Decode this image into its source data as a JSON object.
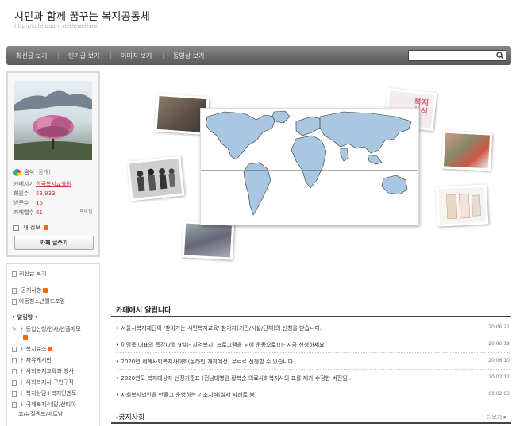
{
  "header": {
    "title": "시민과 함께 꿈꾸는 복지공동체",
    "url": "http://cafe.daum.net/ewelfare"
  },
  "topnav": {
    "items": [
      "최신글 보기",
      "인기글 보기",
      "이미지 보기",
      "동영상 보기"
    ],
    "search_placeholder": ""
  },
  "profile": {
    "owner_label": "음식",
    "owner_sub": "(공개)",
    "stats": [
      {
        "label": "카페지기",
        "value": "한국복지교육원"
      },
      {
        "label": "회원수",
        "value": "53,933"
      },
      {
        "label": "방문수",
        "value": "16"
      },
      {
        "label": "카페앱수",
        "value": "61"
      }
    ],
    "profile_link": "프로필",
    "my_info": "내 정보",
    "write_button": "카페 글쓰기"
  },
  "side_menu": {
    "recent": "최신글 보기",
    "boards_top": [
      "-공지사항",
      "아동청소년월드포럼"
    ],
    "section_title": "• 알림방 •",
    "boards": [
      "ㅏ 등업신청/인사/안플메모",
      "ㅏ 복지뉴스",
      "ㅏ 자유게시판",
      "ㅏ 사회복지교육과 행사",
      "ㅏ 사회복지사 구인구직",
      "ㅏ 복지상담+복지인멘토",
      "ㅏ 국제복지-네팔/산티아",
      "고/뉴질랜드/베트남"
    ]
  },
  "notice": {
    "title": "카페에서 알립니다",
    "items": [
      {
        "text": "서울시복지재단이 '찾아가는 시민복지교육' 참가자(기관/시설/단체)의 신청을 받습니다.",
        "date": "20.06.21"
      },
      {
        "text": "이명묵 대표의 특강(7월 9일)- 지역복지, 프로그램을 넘어 운동으로!!!- 지금 신청하세요",
        "date": "20.06.19"
      },
      {
        "text": "2020년 세계사회복지사대회(온라인 개최예정) 무료로 신청할 수 있습니다.",
        "date": "20.06.10"
      },
      {
        "text": "2020년도 복지대상자 선정기준표 (전남대병원 황복순 의료사회복지사의 표를 제가 수정한 버전임...",
        "date": "20.02.12"
      },
      {
        "text": "사회복지법인을 만들고 운영하는 기초지식(실제 사례로 봄)",
        "date": "09.02.03"
      }
    ]
  },
  "board": {
    "title": "-공지사항",
    "more": "더보기"
  },
  "collage": {
    "book_text_1": "복지",
    "book_text_2": "상식",
    "colors": {
      "map_land": "#a9c7e0",
      "map_border": "#333",
      "accent": "#c33"
    }
  }
}
